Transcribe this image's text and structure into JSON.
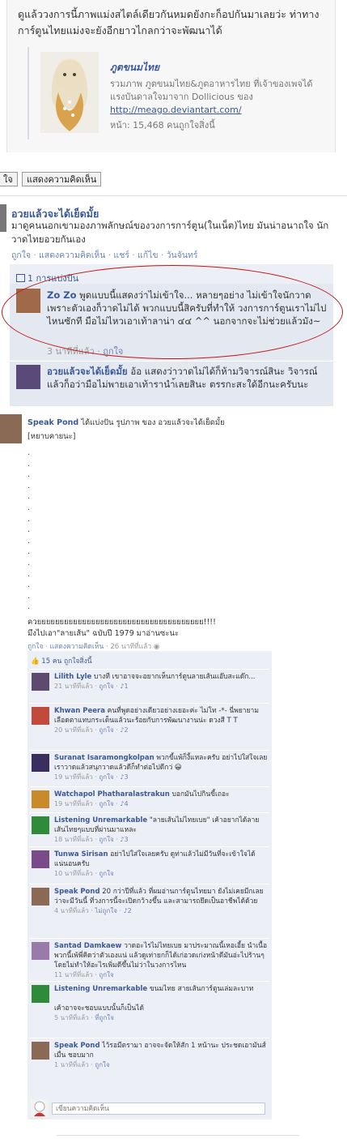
{
  "top_post": {
    "text": "ดูแล้ววงการนี้ภาพแม่งสไตล์เดียวกันหมดยังกะก็อปกันมาเลยว่ะ ท่าทางการ์ตูนไทยแม่งจะยังอีกยาวไกลกว่าจะพัฒนาได้",
    "attachment": {
      "title": "ภูตขนมไทย",
      "description": "รวมภาพ ภูตขนมไทย&ภูตอาหารไทย ที่เจ้าของเพจได้แรงบันดาลใจมาจาก Dollicious ของ",
      "url": "http://meago.deviantart.com/",
      "stats": "หน้า: 15,468 คนถูกใจสิ่งนี้"
    }
  },
  "buttons": {
    "like": "ใจ",
    "comment": "แสดงความคิดเห็น"
  },
  "post2": {
    "author": "อวยแล้วจะได้เย็ดมั้ย",
    "text": "มาดูคนนอกเขามองภาพลักษณ์ของวงการการ์ตูน(ในเน็ต)ไทย มันน่าอนาถใจ นักวาดไทยอวยกันเอง",
    "meta": {
      "like": "ถูกใจ",
      "comment": "แสดงความคิดเห็น",
      "share": "แชร์",
      "edit": "แก้ไข",
      "time": "วันจันทร์"
    },
    "share_count": "1 การแบ่งปัน",
    "comments": [
      {
        "name": "Zo Zo",
        "text": "พูดแบบนี้แสดงว่าไม่เข้าใจ... หลายๆอย่าง ไม่เข้าใจนักวาด เพราะตัวเองก็วาดไม่ได้ พวกแบบนี้สิครับที่ทำให้ วงการการ์ตูนเราไม่ไปไหนซักที มือไม่ไหวเอาเท้าลาน่า ๔๔ ^^ นอกจากจะไม่ช่วยแล้วมัง~",
        "time": "3 นาทีที่แล้ว",
        "like": "ถูกใจ"
      },
      {
        "name": "อวยแล้วจะได้เย็ดมั้ย",
        "text": "อ้อ แสดงว่าวาดไม่ได้ก็ห้ามวิจารณ์สินะ วิจารณ์แล้วก็อว่ามือไม่พายเอาเท้ารานำ้เลยสินะ ตรรกะสะใด้อีกนะครับนะ"
      }
    ]
  },
  "speak_pond": {
    "author": "Speak Pond",
    "shared_text": "ได้แบ่งปัน รูปภาพ ของ อวยแล้วจะได้เย็ดมั้ย",
    "tag": "[หยาบคายนะ]",
    "dots": [
      ".",
      ".",
      ".",
      ".",
      ".",
      ".",
      ".",
      ".",
      ".",
      ".",
      ".",
      ".",
      ".",
      ".",
      "."
    ],
    "line1": "ควยยยยยยยยยยยยยยยยยยยยยยยยยยยยยยยยยยยยย!!!!",
    "line2": "มึงไปเอา\"ลายเส้น\" ฉบับปี 1979 มาอ่านซะนะ",
    "meta": {
      "like": "ถูกใจ",
      "comment": "แสดงความคิดเห็น",
      "time": "26 นาทีที่แล้ว"
    },
    "likes": "15 คน ถูกใจสิ่งนี้",
    "write_placeholder": "เขียนความคิดเห็น",
    "comments": [
      {
        "name": "Lilith Lyle",
        "text": "บางที เขาอาจจะอยากเห็นการ์ตูนลายเส้นแอ๊บสะแด๊ก...",
        "time": "21 นาทีที่แล้ว",
        "like": "ถูกใจ",
        "count": "1",
        "avatar_color": "#5d4a6e"
      },
      {
        "name": "Khwan Peera",
        "text": "คนที่พูดอย่างเดียวอย่างเยอะค่ะ ไม่โท -*- นี่พยายามเลือดตาแทบกระเด็นแล้วนะร้อยกับการพัฒนางานน่ะ ดวงสี T T",
        "time": "20 นาทีที่แล้ว",
        "like": "ถูกใจ",
        "count": "2",
        "avatar_color": "#c24a3a"
      },
      {
        "name": "Suranat Isaramongkolpan",
        "text": "พวกขี้แพ้ก็งี้แหละครับ อย่าไปใส่ใจเลย เราวาดแล้วสนุกวาดแล้วดีก็ทำต่อไปดีกว่ 😀",
        "time": "19 นาทีที่แล้ว",
        "like": "ถูกใจ",
        "count": "3",
        "avatar_color": "#3a2e5e"
      },
      {
        "name": "Watchapol Phatharalastrakun",
        "text": "บอกมันไปกินขี้เถอะ",
        "time": "19 นาทีที่แล้ว",
        "like": "ถูกใจ",
        "count": "4",
        "avatar_color": "#c98a2a"
      },
      {
        "name": "Listening Unremarkable",
        "text": "\"ลายเส้นไม่ไทยเบย\" เค้าอยากได้ลายเส้นไทยๆแบบที่ผ่านมาแหละ",
        "time": "18 นาทีที่แล้ว",
        "like": "ถูกใจ",
        "count": "3",
        "avatar_color": "#2f8a3a"
      },
      {
        "name": "Tunwa Sirisan",
        "text": "อย่าไปใส่ใจเลยครับ ดูท่าแล้วไม่มีวันที่จะเข้าใจได้แน่นอนครับ",
        "time": "10 นาทีที่แล้ว",
        "like": "ถูกใจ",
        "count": "",
        "avatar_color": "#7a4a8a"
      },
      {
        "name": "Speak Pond",
        "text": "20 กว่าปีที่แล้ว ที่ผมอ่านการ์ตูนไทยมา ยังไม่เคยมีกเลยว่าจะมีวันนี้ ที่วงการนี้จะเปิดกว้างขึ้น และสามารถยึดเป็นอาชีพได้ด้วย",
        "time": "4 นาทีที่แล้ว",
        "like": "ไม่ถูกใจ",
        "count": "2",
        "avatar_color": "#8a6a55"
      },
      {
        "name": "Santad Damkaew",
        "text": "วาดอะไรไม่ไทยเบย มาประมาณนี้เหอเอี้ย นำเนื้อพวกนี้เพ้พี่คิดว่าตัวเองแน่ แล้วดูเท่ายกก็ได้เก่อวดเก่งหน้าดีมันอ่ะไปร้านๆโดยไม่ทำให้อะไรเพิ่มดีขึ้นไม่ว่าในวงการไหน",
        "time": "11 นาทีที่แล้ว",
        "like": "ถูกใจ",
        "count": "",
        "avatar_color": "#9a7aa8"
      },
      {
        "name": "Listening Unremarkable",
        "text": "ขนมไทย สายเส้นการ์ตูนเล่มละบาท",
        "text2": "เค้าอาจจะชอบแบบนั้นก็เป็นได้",
        "time": "5 นาทีที่แล้ว",
        "like": "ที่ถูกใจ",
        "count": "",
        "avatar_color": "#2f8a3a"
      },
      {
        "name": "Speak Pond",
        "text": "ไว้รอมีตรามา อาจจะจัดให้สัก 1 หน้านะ ประชดเอามันส์เมื่น ชอบมาก",
        "time": "1 นาทีที่แล้ว",
        "like": "ถูกใจ",
        "count": "",
        "avatar_color": "#8a6a55"
      }
    ]
  },
  "colors": {
    "link": "#3b5998",
    "box": "#eceff5",
    "ellipse": "#c01818"
  }
}
